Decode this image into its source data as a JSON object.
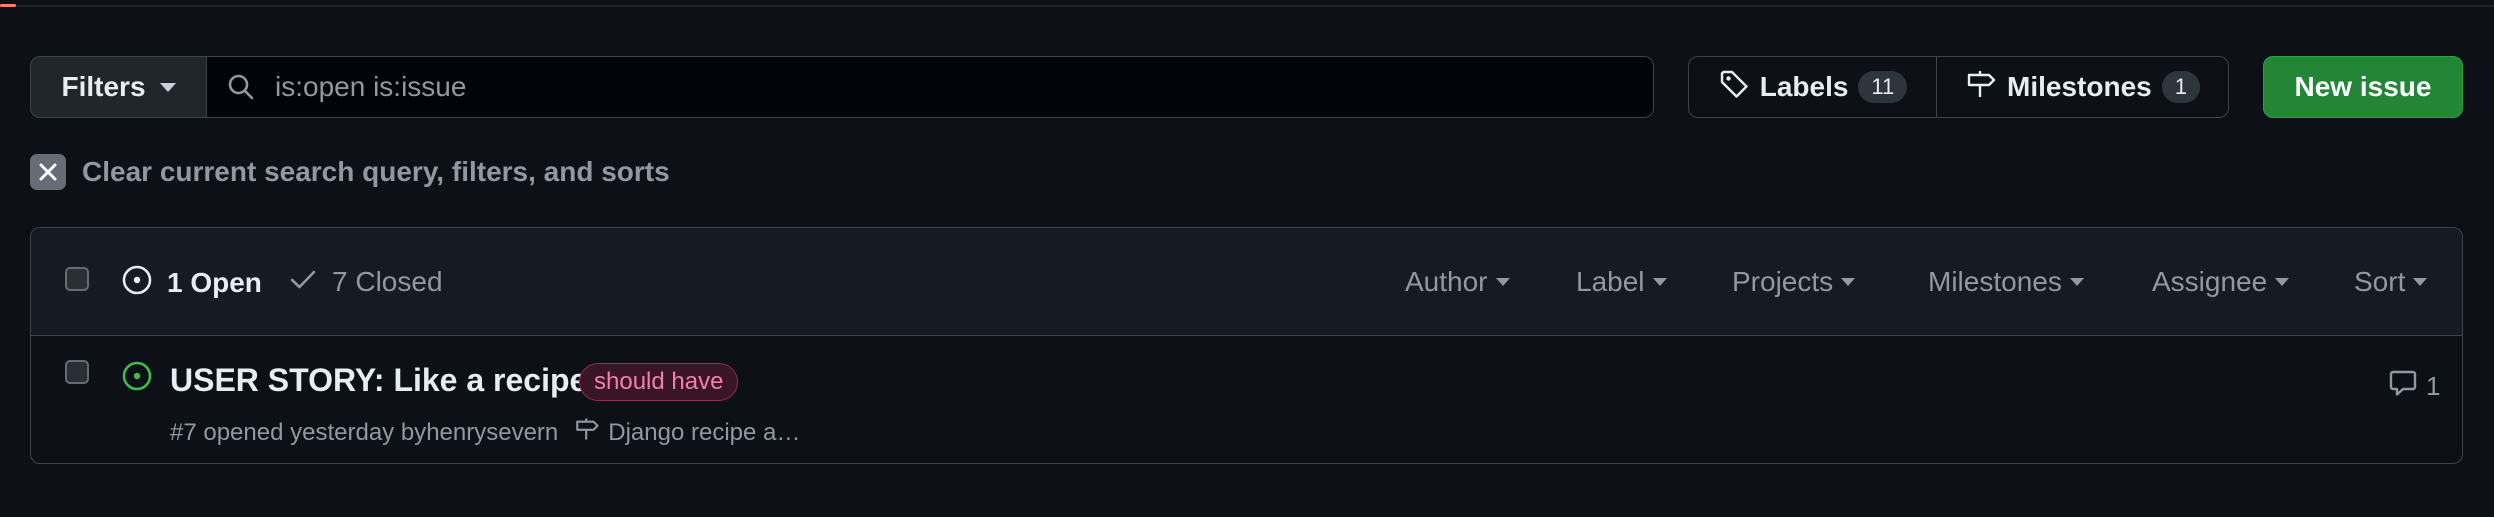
{
  "toolbar": {
    "filters_label": "Filters",
    "search_value": "is:open is:issue",
    "labels_label": "Labels",
    "labels_count": "11",
    "milestones_label": "Milestones",
    "milestones_count": "1",
    "new_issue_label": "New issue"
  },
  "clear_filters": {
    "label": "Clear current search query, filters, and sorts"
  },
  "issues_header": {
    "open_label": "1 Open",
    "closed_label": "7 Closed",
    "filters": {
      "author": "Author",
      "label": "Label",
      "projects": "Projects",
      "milestones": "Milestones",
      "assignee": "Assignee",
      "sort": "Sort"
    }
  },
  "issues": [
    {
      "title": "USER STORY: Like a recipe",
      "label": "should have",
      "label_colors": {
        "text": "#f37fb0",
        "border": "#8a2f55",
        "bg": "#3a1526"
      },
      "meta_prefix": "#7 opened yesterday by ",
      "author": "henrysevern",
      "milestone": "Django recipe a…",
      "comments": "1"
    }
  ],
  "colors": {
    "background": "#0d1117",
    "header_bg": "#151b23",
    "border": "#3d444d",
    "primary_button": "#238636",
    "open_icon": "#3fb950",
    "muted_text": "#9198a1"
  }
}
